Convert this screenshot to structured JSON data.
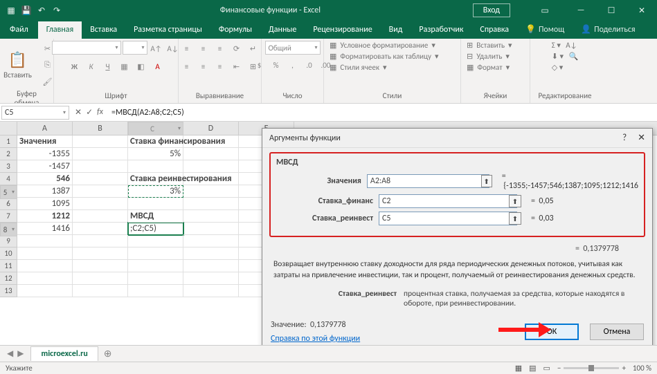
{
  "titlebar": {
    "title": "Финансовые функции  -  Excel",
    "login": "Вход"
  },
  "tabs": [
    "Файл",
    "Главная",
    "Вставка",
    "Разметка страницы",
    "Формулы",
    "Данные",
    "Рецензирование",
    "Вид",
    "Разработчик",
    "Справка"
  ],
  "help_tabs": {
    "help": "Помощ",
    "share": "Поделиться"
  },
  "ribbon": {
    "clipboard": {
      "paste": "Вставить",
      "label": "Буфер обмена"
    },
    "font": {
      "label": "Шрифт",
      "b": "Ж",
      "i": "К",
      "u": "Ч"
    },
    "align": {
      "label": "Выравнивание"
    },
    "number": {
      "label": "Число",
      "format": "Общий"
    },
    "styles": {
      "label": "Стили",
      "cond": "Условное форматирование",
      "table": "Форматировать как таблицу",
      "cell": "Стили ячеек"
    },
    "cells": {
      "label": "Ячейки",
      "insert": "Вставить",
      "delete": "Удалить",
      "format": "Формат"
    },
    "edit": {
      "label": "Редактирование"
    }
  },
  "namebox": "C5",
  "formula": "=МВСД(A2:A8;С2;С5)",
  "sheet": {
    "cols": [
      "A",
      "B",
      "C",
      "D",
      "E"
    ],
    "rows": [
      {
        "n": "1",
        "A": "Значения",
        "C": "Ставка финансирования",
        "bold": true
      },
      {
        "n": "2",
        "A": "-1355",
        "C": "5%",
        "cnum": true
      },
      {
        "n": "3",
        "A": "-1457"
      },
      {
        "n": "4",
        "A": "546",
        "C": "Ставка реинвестирования",
        "bold": true
      },
      {
        "n": "5",
        "A": "1387",
        "C": "3%",
        "cnum": true,
        "csel": true
      },
      {
        "n": "6",
        "A": "1095"
      },
      {
        "n": "7",
        "A": "1212",
        "C": "МВСД",
        "bold": true
      },
      {
        "n": "8",
        "A": "1416",
        "C": ";C2;C5)",
        "active": true
      },
      {
        "n": "9"
      },
      {
        "n": "10"
      },
      {
        "n": "11"
      },
      {
        "n": "12"
      },
      {
        "n": "13"
      }
    ]
  },
  "dialog": {
    "title": "Аргументы функции",
    "fn": "МВСД",
    "args": [
      {
        "label": "Значения",
        "value": "A2:A8",
        "result": "{-1355;-1457;546;1387;1095;1212;1416"
      },
      {
        "label": "Ставка_финанс",
        "value": "C2",
        "result": "0,05"
      },
      {
        "label": "Ставка_реинвест",
        "value": "C5",
        "result": "0,03"
      }
    ],
    "fn_result": "0,1379778",
    "desc": "Возвращает внутреннюю ставку доходности для ряда периодических денежных потоков, учитывая как затраты на привлечение инвестиции, так и процент, получаемый от реинвестирования денежных средств.",
    "arg_desc_lbl": "Ставка_реинвест",
    "arg_desc": "процентная ставка, получаемая за средства, которые находятся в обороте, при реинвестировании.",
    "value_lbl": "Значение:",
    "value": "0,1379778",
    "help": "Справка по этой функции",
    "ok": "ОК",
    "cancel": "Отмена"
  },
  "sheettab": "microexcel.ru",
  "status": {
    "mode": "Укажите",
    "zoom": "100 %"
  }
}
